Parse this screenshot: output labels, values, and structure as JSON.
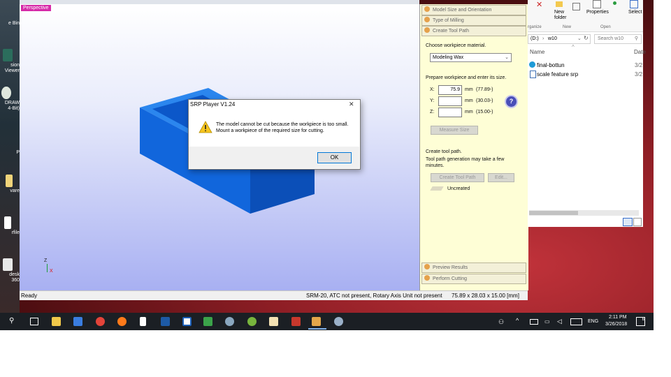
{
  "viewport": {
    "label": "Perspective",
    "axis_z": "Z",
    "axis_x": "X"
  },
  "status": {
    "left": "Ready",
    "middle": "SRM-20, ATC not present, Rotary Axis Unit not present",
    "right": "75.89 x 28.03 x 15.00 [mm]"
  },
  "panel": {
    "sections_top": [
      "Model Size and Orientation",
      "Type of Milling",
      "Create Tool Path"
    ],
    "sections_bottom": [
      "Preview Results",
      "Perform Cutting"
    ],
    "material_label": "Choose workpiece material.",
    "material_value": "Modeling Wax",
    "size_label": "Prepare workpiece and enter its size.",
    "axes": [
      {
        "axis": "X:",
        "value": "75.9",
        "unit": "mm",
        "hint": "(77.89-)"
      },
      {
        "axis": "Y:",
        "value": "",
        "unit": "mm",
        "hint": "(30.03-)"
      },
      {
        "axis": "Z:",
        "value": "",
        "unit": "mm",
        "hint": "(15.00-)"
      }
    ],
    "measure_button": "Measure Size",
    "toolpath_title": "Create tool path.",
    "toolpath_note": "Tool path generation may take a few minutes.",
    "create_button": "Create Tool Path",
    "edit_button": "Edit...",
    "toolpath_status": "Uncreated",
    "help_glyph": "?"
  },
  "dialog": {
    "title": "SRP Player V1.24",
    "close": "✕",
    "line1": "The model cannot be cut because the workpiece is too small.",
    "line2": "Mount a workpiece of the required size for cutting.",
    "ok": "OK",
    "warning_icon": "warning-icon"
  },
  "explorer": {
    "ribbon": {
      "new_folder": "New folder",
      "properties": "Properties",
      "select": "Select",
      "organize": "rganize",
      "new_group": "New",
      "open_group": "Open"
    },
    "path_drive": "(D:)",
    "path_folder": "w10",
    "search_placeholder": "Search w10",
    "col_name": "Name",
    "col_date": "Date",
    "files": [
      {
        "name": "final-bottun",
        "date": "3/2"
      },
      {
        "name": "scale feature srp",
        "date": "3/2"
      }
    ]
  },
  "desktop": {
    "icons": [
      "e Bin",
      "sion Viewer",
      "DRAW 4-Bit)",
      "P",
      "vare",
      "rfile",
      "fi",
      "desk 360"
    ]
  },
  "taskbar": {
    "lang": "ENG",
    "time": "2:11 PM",
    "date": "3/26/2018",
    "notif_count": "6"
  },
  "colors": {
    "model_blue": "#1a6fe0",
    "panel_bg": "#fefed6",
    "persp_tag": "#d62aa8"
  }
}
